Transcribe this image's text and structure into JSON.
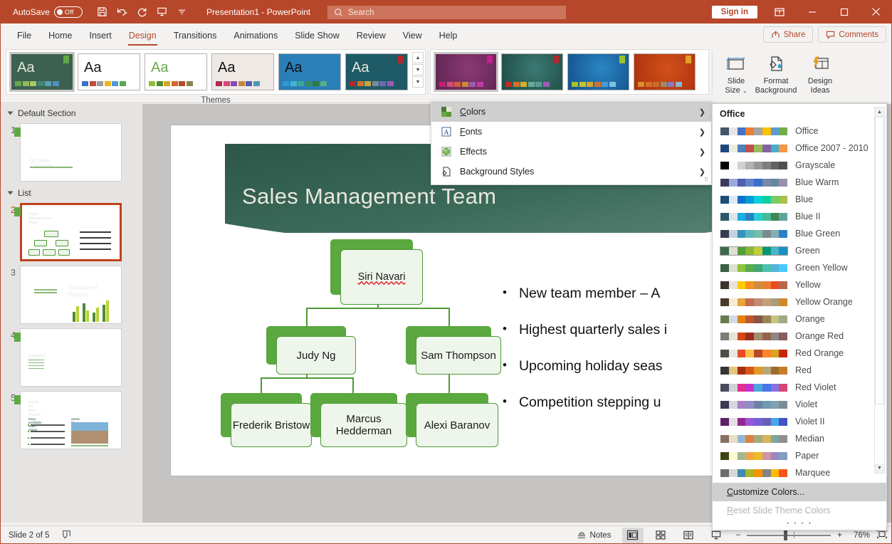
{
  "titlebar": {
    "autosave_label": "AutoSave",
    "autosave_state": "Off",
    "document_title": "Presentation1 - PowerPoint",
    "search_placeholder": "Search",
    "signin_label": "Sign in",
    "icons": [
      "save-icon",
      "undo-icon",
      "redo-icon",
      "start-presentation-icon",
      "customize-qat-icon"
    ],
    "accent_color": "#b7472a"
  },
  "tabs": [
    {
      "label": "File",
      "active": false
    },
    {
      "label": "Home",
      "active": false
    },
    {
      "label": "Insert",
      "active": false
    },
    {
      "label": "Design",
      "active": true
    },
    {
      "label": "Transitions",
      "active": false
    },
    {
      "label": "Animations",
      "active": false
    },
    {
      "label": "Slide Show",
      "active": false
    },
    {
      "label": "Review",
      "active": false
    },
    {
      "label": "View",
      "active": false
    },
    {
      "label": "Help",
      "active": false
    }
  ],
  "tabbar_right": [
    {
      "label": "Share",
      "icon": "share-icon"
    },
    {
      "label": "Comments",
      "icon": "comment-icon"
    }
  ],
  "ribbon": {
    "themes_group_label": "Themes",
    "themes": [
      {
        "name": "theme-facet-green",
        "selected": true,
        "bg": "#3d6151",
        "aa_color": "#e8e6dc",
        "swatches": [
          "#6aa84f",
          "#8fbc5a",
          "#a6c96a",
          "#3b8a7a",
          "#5ba0b5",
          "#4f8fc0"
        ],
        "corner": "#5faa45"
      },
      {
        "name": "theme-office",
        "selected": false,
        "bg": "#ffffff",
        "aa_color": "#1a1a1a",
        "swatches": [
          "#3d6fc4",
          "#c14a3a",
          "#9a9a9a",
          "#e8b71a",
          "#4a9ad4",
          "#58a84f"
        ],
        "corner": ""
      },
      {
        "name": "theme-wisp",
        "selected": false,
        "bg": "#ffffff",
        "aa_color": "#6aa84f",
        "swatches": [
          "#8fbc3f",
          "#4e8a2e",
          "#d9a520",
          "#d4672a",
          "#b5482a",
          "#8a8247"
        ],
        "corner": ""
      },
      {
        "name": "theme-banded",
        "selected": false,
        "bg": "#efe9e6",
        "aa_color": "#111111",
        "swatches": [
          "#b52a4f",
          "#d44a7a",
          "#8a4ab5",
          "#c48a3a",
          "#5a5ab5",
          "#4a9ab5"
        ],
        "corner": ""
      },
      {
        "name": "theme-damask",
        "selected": false,
        "bg": "#2a7fb8",
        "aa_color": "#111111",
        "swatches": [
          "#2f9ad4",
          "#3fb5d4",
          "#3aa89a",
          "#3a8a5a",
          "#2e7a45",
          "#55b08a"
        ],
        "corner": ""
      },
      {
        "name": "theme-ion-boardroom",
        "selected": false,
        "bg": "#1e5a66",
        "aa_color": "#e8e6dc",
        "swatches": [
          "#b5282a",
          "#d4702a",
          "#c9a53a",
          "#7a8a9a",
          "#6a6ab5",
          "#a05ab5"
        ],
        "corner": "#b5282a"
      }
    ],
    "variants": [
      {
        "name": "variant-purple",
        "selected": true,
        "c1": "#5e2352",
        "c2": "#8a3a73",
        "swatches": [
          "#c41f6a",
          "#d4497a",
          "#d4603a",
          "#c98a3a",
          "#a05ab5",
          "#c43aa5"
        ],
        "corner": "#c41f8a"
      },
      {
        "name": "variant-teal",
        "selected": false,
        "c1": "#1f4a45",
        "c2": "#3a7a72",
        "swatches": [
          "#c4281f",
          "#d4702a",
          "#d4b02a",
          "#6aa89a",
          "#5a9a9a",
          "#a05ab5"
        ],
        "corner": "#b5282a"
      },
      {
        "name": "variant-blue",
        "selected": false,
        "c1": "#12508a",
        "c2": "#2a86c4",
        "swatches": [
          "#a5c42a",
          "#c4c42a",
          "#d4a52a",
          "#d4702a",
          "#4a9ad4",
          "#7ac4e0"
        ],
        "corner": "#9ac42a"
      },
      {
        "name": "variant-orange",
        "selected": false,
        "c1": "#a8300f",
        "c2": "#d4501a",
        "swatches": [
          "#d4902a",
          "#d4702a",
          "#c4702a",
          "#a08a6a",
          "#8a7ac4",
          "#8ab5d4"
        ],
        "corner": "#e0a02a"
      }
    ],
    "buttons": [
      {
        "label": "Slide\nSize",
        "icon": "slide-size-icon",
        "has_caret": true
      },
      {
        "label": "Format\nBackground",
        "icon": "format-background-icon",
        "has_caret": false
      },
      {
        "label": "Design\nIdeas",
        "icon": "design-ideas-icon",
        "has_caret": false
      }
    ],
    "gallery_scroll_icons": [
      "scroll-up-icon",
      "scroll-down-icon",
      "more-icon"
    ]
  },
  "dropdown_menu": {
    "items": [
      {
        "label": "Colors",
        "accel": "C",
        "icon": "colors-icon",
        "highlighted": true,
        "submenu": true
      },
      {
        "label": "Fonts",
        "accel": "F",
        "icon": "fonts-icon",
        "highlighted": false,
        "submenu": true
      },
      {
        "label": "Effects",
        "accel": "",
        "icon": "effects-icon",
        "highlighted": false,
        "submenu": true
      },
      {
        "label": "Background Styles",
        "accel": "",
        "icon": "background-styles-icon",
        "highlighted": false,
        "submenu": true
      }
    ]
  },
  "color_panel": {
    "heading": "Office",
    "selected": "Green",
    "schemes": [
      {
        "name": "Office",
        "colors": [
          "#44546a",
          "#e7e6e6",
          "#4472c4",
          "#ed7d31",
          "#a5a5a5",
          "#ffc000",
          "#5b9bd5",
          "#70ad47"
        ]
      },
      {
        "name": "Office 2007 - 2010",
        "colors": [
          "#1f497d",
          "#eeece1",
          "#4f81bd",
          "#c0504d",
          "#9bbb59",
          "#8064a2",
          "#4bacc6",
          "#f79646"
        ]
      },
      {
        "name": "Grayscale",
        "colors": [
          "#000000",
          "#f8f8f8",
          "#d0d0d0",
          "#b2b2b2",
          "#979797",
          "#7f7f7f",
          "#636363",
          "#505050"
        ]
      },
      {
        "name": "Blue Warm",
        "colors": [
          "#3b3b5c",
          "#9aabdb",
          "#4f5fae",
          "#6583c7",
          "#3a6fd0",
          "#7a87a8",
          "#5f8aa0",
          "#9a8fa8"
        ]
      },
      {
        "name": "Blue",
        "colors": [
          "#1a4e79",
          "#dce9f5",
          "#0f6fc6",
          "#009dd9",
          "#0bd0d9",
          "#10cf9b",
          "#7cca62",
          "#a5c249"
        ]
      },
      {
        "name": "Blue II",
        "colors": [
          "#2b5a6b",
          "#dfe3e6",
          "#1cade4",
          "#2683c6",
          "#27ced7",
          "#42ba97",
          "#3e8853",
          "#62a39f"
        ]
      },
      {
        "name": "Blue Green",
        "colors": [
          "#3b3b4f",
          "#c3d1e0",
          "#3494ba",
          "#58b6c0",
          "#75bda7",
          "#7a8c8e",
          "#84acb6",
          "#2683c6"
        ]
      },
      {
        "name": "Green",
        "colors": [
          "#3c6b4a",
          "#e0ded3",
          "#549e39",
          "#8ab833",
          "#c0cf3a",
          "#029676",
          "#4ab5c4",
          "#1c8ec4"
        ]
      },
      {
        "name": "Green Yellow",
        "colors": [
          "#3a5f44",
          "#dfe0d0",
          "#8cc63f",
          "#5bab4c",
          "#43a674",
          "#4cc3b0",
          "#54b5d6",
          "#49c9ff"
        ]
      },
      {
        "name": "Yellow",
        "colors": [
          "#3a332b",
          "#e8e3d8",
          "#ffca08",
          "#f8931d",
          "#ce8d3e",
          "#ec7c30",
          "#e84c22",
          "#b4684a"
        ]
      },
      {
        "name": "Yellow Orange",
        "colors": [
          "#4a3a2b",
          "#f5ecd5",
          "#e8a33d",
          "#c26d4f",
          "#c18a75",
          "#c4a07a",
          "#a89c7a",
          "#d4872a"
        ]
      },
      {
        "name": "Orange",
        "colors": [
          "#6a7a4f",
          "#cfdbe5",
          "#e48312",
          "#bd582c",
          "#865640",
          "#9b8357",
          "#c6c386",
          "#a0aa87"
        ]
      },
      {
        "name": "Orange Red",
        "colors": [
          "#7b7b7b",
          "#e8e3d8",
          "#d34817",
          "#9b2d1f",
          "#a28e6a",
          "#956251",
          "#918485",
          "#855d5d"
        ]
      },
      {
        "name": "Red Orange",
        "colors": [
          "#4a4f4a",
          "#e8e8e0",
          "#e84c22",
          "#ffbd47",
          "#b64926",
          "#ff8427",
          "#d9a520",
          "#c8250d"
        ]
      },
      {
        "name": "Red",
        "colors": [
          "#353535",
          "#e1c87a",
          "#a5300f",
          "#d55816",
          "#e19825",
          "#b7a676",
          "#9c6d2e",
          "#c87b2a"
        ]
      },
      {
        "name": "Red Violet",
        "colors": [
          "#4a4a5c",
          "#d2d2d9",
          "#e32d91",
          "#c830cc",
          "#4ea6dc",
          "#4775e7",
          "#8971e1",
          "#d54773"
        ]
      },
      {
        "name": "Violet",
        "colors": [
          "#3a3a52",
          "#d8d5dd",
          "#a680c4",
          "#8f8fc4",
          "#6e81a5",
          "#6f9bb0",
          "#83a0ad",
          "#7d8d95"
        ]
      },
      {
        "name": "Violet II",
        "colors": [
          "#5b2167",
          "#e4dfe6",
          "#92278f",
          "#9b57d3",
          "#755dd9",
          "#665eb8",
          "#45a5ed",
          "#4052c4"
        ]
      },
      {
        "name": "Median",
        "colors": [
          "#8a6f63",
          "#e8dfc8",
          "#94b6d2",
          "#dd8047",
          "#a5ab81",
          "#d8b25c",
          "#7ba79d",
          "#968c8c"
        ]
      },
      {
        "name": "Paper",
        "colors": [
          "#3d4413",
          "#fdf9d2",
          "#a5b592",
          "#f3a447",
          "#e7bc29",
          "#d092a7",
          "#9c85c0",
          "#809ec2"
        ]
      },
      {
        "name": "Marquee",
        "colors": [
          "#6c6c6c",
          "#d8d8d8",
          "#418ab3",
          "#a6b727",
          "#f69200",
          "#838383",
          "#feb907",
          "#f4561a"
        ]
      }
    ],
    "footer": [
      {
        "label": "Customize Colors...",
        "accel": "C",
        "enabled": true,
        "highlighted": true
      },
      {
        "label": "Reset Slide Theme Colors",
        "accel": "R",
        "enabled": false,
        "highlighted": false
      }
    ]
  },
  "thumbpane": {
    "sections": [
      {
        "name": "Default Section",
        "slides": [
          {
            "number": "1",
            "title": "Q3 Sales Campaign",
            "type": "title-slide",
            "active": false
          }
        ]
      },
      {
        "name": "List",
        "slides": [
          {
            "number": "2",
            "title": "Sales Management Team",
            "type": "org-chart",
            "active": true
          },
          {
            "number": "3",
            "title": "Southwest Region",
            "type": "section-slide",
            "active": false
          },
          {
            "number": "4",
            "title": "Southwest Sales",
            "type": "chart-slide",
            "active": false
          },
          {
            "number": "5",
            "title": "Santa Fe, New Mexico",
            "type": "content-slide",
            "active": false
          }
        ]
      }
    ]
  },
  "slide": {
    "title": "Sales Management Team",
    "org_chart": {
      "nodes": [
        {
          "id": "n1",
          "name": "Siri Navari",
          "level": 1,
          "misspelled": true
        },
        {
          "id": "n2",
          "name": "Judy Ng",
          "level": 2,
          "misspelled": false
        },
        {
          "id": "n3",
          "name": "Sam Thompson",
          "level": 2,
          "misspelled": false
        },
        {
          "id": "n4",
          "name": "Frederik Bristow",
          "level": 3,
          "misspelled": false
        },
        {
          "id": "n5",
          "name": "Marcus Hedderman",
          "level": 3,
          "misspelled": false
        },
        {
          "id": "n6",
          "name": "Alexi Baranov",
          "level": 3,
          "misspelled": false
        }
      ],
      "accent_color": "#4e9a36",
      "shadow_color": "#5aa83e",
      "fill_color": "#eef5eb"
    },
    "bullets": [
      "New team member – A",
      "Highest quarterly sales i",
      "Upcoming holiday seas",
      "Competition stepping u"
    ],
    "banner_color_top": "#2f5a4c",
    "banner_color_bottom": "#4a7a6a"
  },
  "statusbar": {
    "slide_indicator": "Slide 2 of 5",
    "accessibility_icon": "accessibility-icon",
    "notes_label": "Notes",
    "views": [
      {
        "name": "normal-view",
        "active": true
      },
      {
        "name": "slide-sorter-view",
        "active": false
      },
      {
        "name": "reading-view",
        "active": false
      },
      {
        "name": "slideshow-view",
        "active": false
      }
    ],
    "zoom_out": "−",
    "zoom_in": "+",
    "zoom_level": "76%",
    "fit_icon": "fit-slide-icon"
  }
}
